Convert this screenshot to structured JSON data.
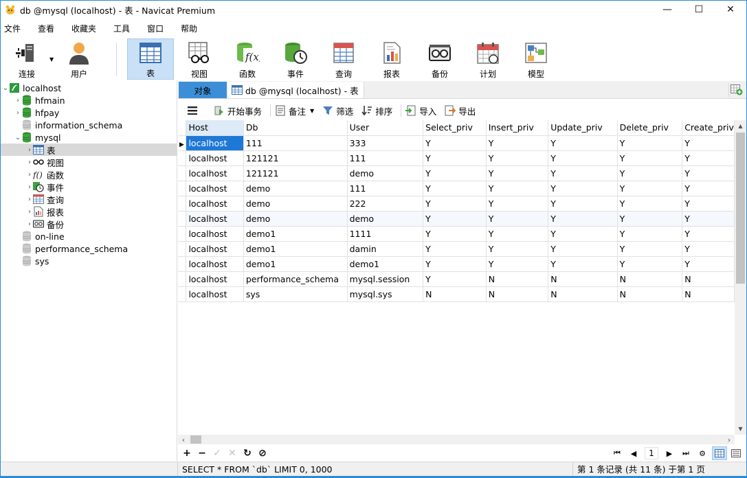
{
  "window": {
    "title": "db @mysql (localhost) - 表 - Navicat Premium",
    "minimize": "—",
    "maximize": "☐",
    "close": "✕"
  },
  "menu": [
    "文件",
    "查看",
    "收藏夹",
    "工具",
    "窗口",
    "帮助"
  ],
  "toolbar": {
    "items": [
      {
        "label": "连接",
        "icon": "plug-icon"
      },
      {
        "label": "用户",
        "icon": "user-icon"
      },
      {
        "label": "表",
        "icon": "table-icon"
      },
      {
        "label": "视图",
        "icon": "view-icon"
      },
      {
        "label": "函数",
        "icon": "function-icon"
      },
      {
        "label": "事件",
        "icon": "event-icon"
      },
      {
        "label": "查询",
        "icon": "query-icon"
      },
      {
        "label": "报表",
        "icon": "report-icon"
      },
      {
        "label": "备份",
        "icon": "backup-icon"
      },
      {
        "label": "计划",
        "icon": "schedule-icon"
      },
      {
        "label": "模型",
        "icon": "model-icon"
      }
    ],
    "active": "表"
  },
  "tree": {
    "rows": [
      {
        "label": "localhost",
        "level": 0,
        "expanded": true,
        "icon": "connection-icon"
      },
      {
        "label": "hfmain",
        "level": 1,
        "expanded": false,
        "icon": "database-icon"
      },
      {
        "label": "hfpay",
        "level": 1,
        "expanded": false,
        "icon": "database-icon"
      },
      {
        "label": "information_schema",
        "level": 1,
        "expanded": null,
        "icon": "database-closed-icon"
      },
      {
        "label": "mysql",
        "level": 1,
        "expanded": true,
        "icon": "database-icon"
      },
      {
        "label": "表",
        "level": 2,
        "expanded": false,
        "icon": "table-icon",
        "selected": true
      },
      {
        "label": "视图",
        "level": 2,
        "expanded": false,
        "icon": "view-icon"
      },
      {
        "label": "函数",
        "level": 2,
        "expanded": false,
        "icon": "function-icon"
      },
      {
        "label": "事件",
        "level": 2,
        "expanded": false,
        "icon": "event-icon"
      },
      {
        "label": "查询",
        "level": 2,
        "expanded": false,
        "icon": "query-icon"
      },
      {
        "label": "报表",
        "level": 2,
        "expanded": false,
        "icon": "report-icon"
      },
      {
        "label": "备份",
        "level": 2,
        "expanded": false,
        "icon": "backup-icon"
      },
      {
        "label": "on-line",
        "level": 1,
        "expanded": null,
        "icon": "database-closed-icon"
      },
      {
        "label": "performance_schema",
        "level": 1,
        "expanded": null,
        "icon": "database-closed-icon"
      },
      {
        "label": "sys",
        "level": 1,
        "expanded": null,
        "icon": "database-closed-icon"
      }
    ]
  },
  "tabs": {
    "objects_label": "对象",
    "doc_label": "db @mysql (localhost) - 表"
  },
  "subtoolbar": {
    "begin_tx": "开始事务",
    "memo": "备注",
    "filter": "筛选",
    "sort": "排序",
    "import": "导入",
    "export": "导出"
  },
  "grid": {
    "columns": [
      "Host",
      "Db",
      "User",
      "Select_priv",
      "Insert_priv",
      "Update_priv",
      "Delete_priv",
      "Create_priv"
    ],
    "rows": [
      [
        "localhost",
        "111",
        "333",
        "Y",
        "Y",
        "Y",
        "Y",
        "Y"
      ],
      [
        "localhost",
        "121121",
        "111",
        "Y",
        "Y",
        "Y",
        "Y",
        "Y"
      ],
      [
        "localhost",
        "121121",
        "demo",
        "Y",
        "Y",
        "Y",
        "Y",
        "Y"
      ],
      [
        "localhost",
        "demo",
        "111",
        "Y",
        "Y",
        "Y",
        "Y",
        "Y"
      ],
      [
        "localhost",
        "demo",
        "222",
        "Y",
        "Y",
        "Y",
        "Y",
        "Y"
      ],
      [
        "localhost",
        "demo",
        "demo",
        "Y",
        "Y",
        "Y",
        "Y",
        "Y"
      ],
      [
        "localhost",
        "demo1",
        "1111",
        "Y",
        "Y",
        "Y",
        "Y",
        "Y"
      ],
      [
        "localhost",
        "demo1",
        "damin",
        "Y",
        "Y",
        "Y",
        "Y",
        "Y"
      ],
      [
        "localhost",
        "demo1",
        "demo1",
        "Y",
        "Y",
        "Y",
        "Y",
        "Y"
      ],
      [
        "localhost",
        "performance_schema",
        "mysql.session",
        "Y",
        "N",
        "N",
        "N",
        "N"
      ],
      [
        "localhost",
        "sys",
        "mysql.sys",
        "N",
        "N",
        "N",
        "N",
        "N"
      ]
    ]
  },
  "pager": {
    "page": "1"
  },
  "status": {
    "sql": "SELECT * FROM `db` LIMIT 0, 1000",
    "records": "第 1 条记录 (共 11 条) 于第 1 页"
  }
}
